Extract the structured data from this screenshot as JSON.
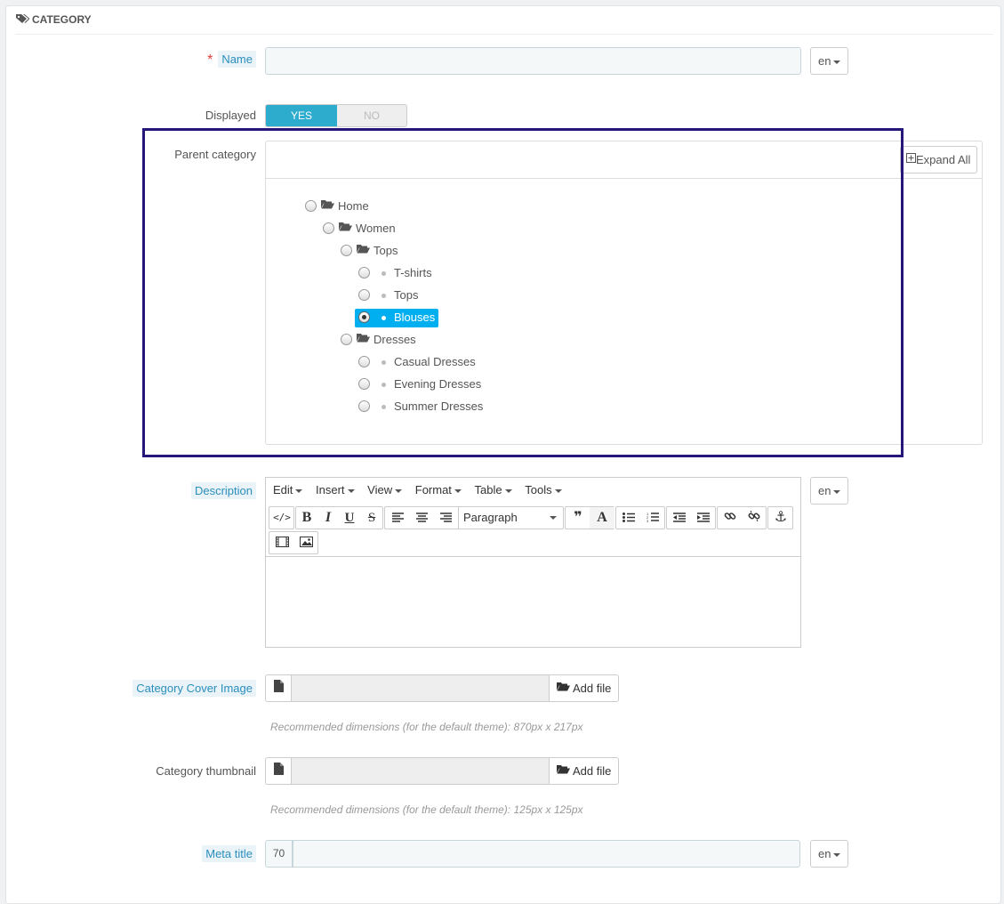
{
  "panel": {
    "heading": "CATEGORY"
  },
  "fields": {
    "name_label": "Name",
    "required_mark": "*",
    "displayed_label": "Displayed",
    "displayed_yes": "YES",
    "displayed_no": "NO",
    "parent_category_label": "Parent category",
    "description_label": "Description",
    "cover_image_label": "Category Cover Image",
    "cover_image_help": "Recommended dimensions (for the default theme): 870px x 217px",
    "thumbnail_label": "Category thumbnail",
    "thumbnail_help": "Recommended dimensions (for the default theme): 125px x 125px",
    "meta_title_label": "Meta title",
    "meta_title_counter": "70"
  },
  "lang_selector": "en",
  "tree": {
    "expand_all": "Expand All",
    "items": [
      {
        "label": "Home",
        "type": "folder",
        "selected": false
      },
      {
        "label": "Women",
        "type": "folder",
        "selected": false
      },
      {
        "label": "Tops",
        "type": "folder",
        "selected": false
      },
      {
        "label": "T-shirts",
        "type": "leaf",
        "selected": false
      },
      {
        "label": "Tops",
        "type": "leaf",
        "selected": false
      },
      {
        "label": "Blouses",
        "type": "leaf",
        "selected": true
      },
      {
        "label": "Dresses",
        "type": "folder",
        "selected": false
      },
      {
        "label": "Casual Dresses",
        "type": "leaf",
        "selected": false
      },
      {
        "label": "Evening Dresses",
        "type": "leaf",
        "selected": false
      },
      {
        "label": "Summer Dresses",
        "type": "leaf",
        "selected": false
      }
    ]
  },
  "editor": {
    "menu": [
      "Edit",
      "Insert",
      "View",
      "Format",
      "Table",
      "Tools"
    ],
    "format_select": "Paragraph",
    "toolbar_icons": [
      "source-code-icon",
      "bold-icon",
      "italic-icon",
      "underline-icon",
      "strikethrough-icon",
      "align-left-icon",
      "align-center-icon",
      "align-right-icon",
      "blockquote-icon",
      "text-color-icon",
      "bullet-list-icon",
      "numbered-list-icon",
      "outdent-icon",
      "indent-icon",
      "link-icon",
      "unlink-icon",
      "anchor-icon",
      "media-icon",
      "image-icon"
    ],
    "bold_glyph": "B",
    "italic_glyph": "I",
    "underline_glyph": "U",
    "strike_glyph": "S",
    "color_glyph": "A",
    "quote_glyph": "❞"
  },
  "file_button": "Add file",
  "colors": {
    "accent": "#2eacce",
    "selected": "#00aff0",
    "highlight_box": "#25177a",
    "required": "#e23c3c"
  }
}
